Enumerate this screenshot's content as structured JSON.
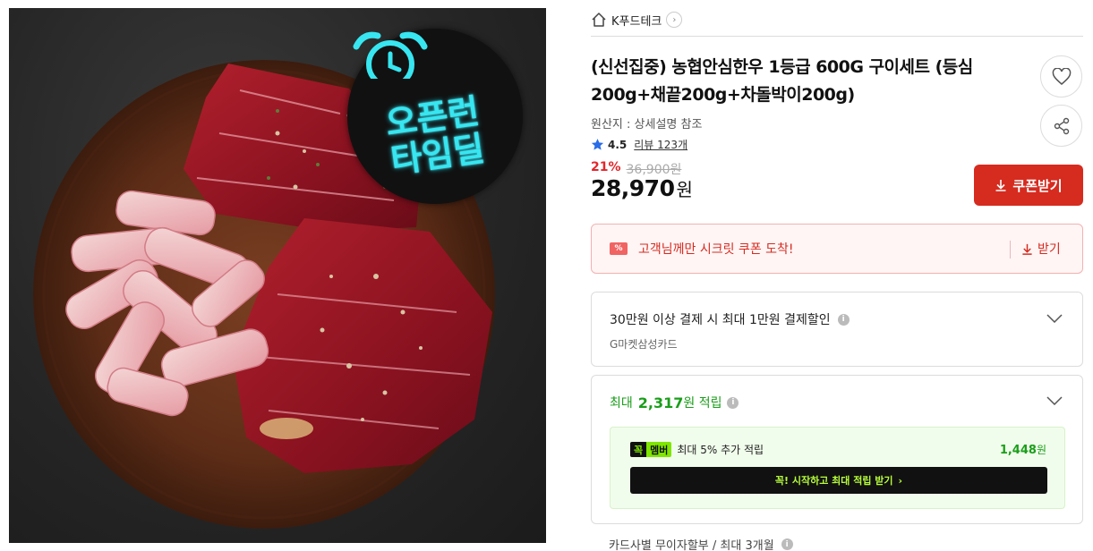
{
  "colors": {
    "accent_red": "#d62b1f",
    "points_green": "#1a9e1a",
    "member_green": "#7fe600",
    "timedeal_cyan": "#37e6f0"
  },
  "product_image": {
    "badge_line1": "오픈런",
    "badge_line2": "타임딜",
    "badge_icon": "alarm-clock-icon"
  },
  "seller": {
    "name": "K푸드테크",
    "home_icon": "home-icon",
    "chevron_icon": "chevron-right-icon",
    "chevron_glyph": "›"
  },
  "product": {
    "title_line1": "(신선집중) 농협안심한우 1등급 600G 구이세트 (등심",
    "title_line2": "200g+채끝200g+차돌박이200g)",
    "origin": "원산지 : 상세설명 참조",
    "rating": "4.5",
    "review_label": "리뷰 123개"
  },
  "price": {
    "discount": "21%",
    "original": "36,900원",
    "sale_amount": "28,970",
    "sale_unit": "원"
  },
  "buttons": {
    "coupon": "쿠폰받기",
    "wish_icon": "heart-icon",
    "share_icon": "share-icon"
  },
  "secret_coupon": {
    "icon_text": "%",
    "text": "고객님께만 시크릿 쿠폰 도착!",
    "get_label": "받기"
  },
  "card_discount": {
    "title": "30만원 이상 결제 시 최대 1만원 결제할인",
    "sub": "G마켓삼성카드",
    "info_glyph": "i"
  },
  "points": {
    "prefix": "최대",
    "amount": "2,317",
    "suffix": "원 적립",
    "member_badge_1": "꼭",
    "member_badge_2": "멤버",
    "member_text": "최대 5% 추가 적립",
    "member_amount": "1,448",
    "member_unit": "원",
    "member_cta": "꼭! 시작하고 최대 적립 받기",
    "member_cta_arrow": "›"
  },
  "installment": {
    "text": "카드사별 무이자할부 / 최대 3개월"
  }
}
